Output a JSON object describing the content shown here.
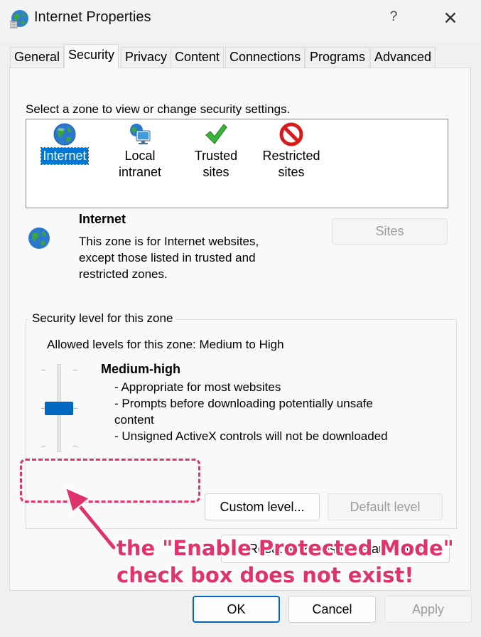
{
  "window": {
    "title": "Internet Properties",
    "help": "?",
    "close": "✕"
  },
  "tabs": [
    {
      "label": "General"
    },
    {
      "label": "Security",
      "active": true
    },
    {
      "label": "Privacy"
    },
    {
      "label": "Content"
    },
    {
      "label": "Connections"
    },
    {
      "label": "Programs"
    },
    {
      "label": "Advanced"
    }
  ],
  "zone_prompt": "Select a zone to view or change security settings.",
  "zones": [
    {
      "line1": "Internet",
      "line2": "",
      "icon": "globe-icon",
      "selected": true
    },
    {
      "line1": "Local",
      "line2": "intranet",
      "icon": "network-computer-icon"
    },
    {
      "line1": "Trusted",
      "line2": "sites",
      "icon": "checkmark-icon"
    },
    {
      "line1": "Restricted",
      "line2": "sites",
      "icon": "no-entry-icon"
    }
  ],
  "zone_info": {
    "name": "Internet",
    "desc1": "This zone is for Internet websites,",
    "desc2": "except those listed in trusted and",
    "desc3": "restricted zones.",
    "sites_button": "Sites"
  },
  "security_level": {
    "group_title": "Security level for this zone",
    "allowed": "Allowed levels for this zone: Medium to High",
    "level_name": "Medium-high",
    "bullets": [
      "- Appropriate for most websites",
      "- Prompts before downloading potentially unsafe",
      "content",
      "- Unsigned ActiveX controls will not be downloaded"
    ],
    "custom_level": "Custom level...",
    "default_level": "Default level"
  },
  "reset_button": "Reset all zones to default level",
  "footer": {
    "ok": "OK",
    "cancel": "Cancel",
    "apply": "Apply"
  },
  "annotation": {
    "line1": "the \"Enable Protected Mode\"",
    "line2": "check box does not exist!",
    "color": "#e0336b"
  },
  "colors": {
    "accent": "#0067c0",
    "selection": "#0078d7"
  }
}
